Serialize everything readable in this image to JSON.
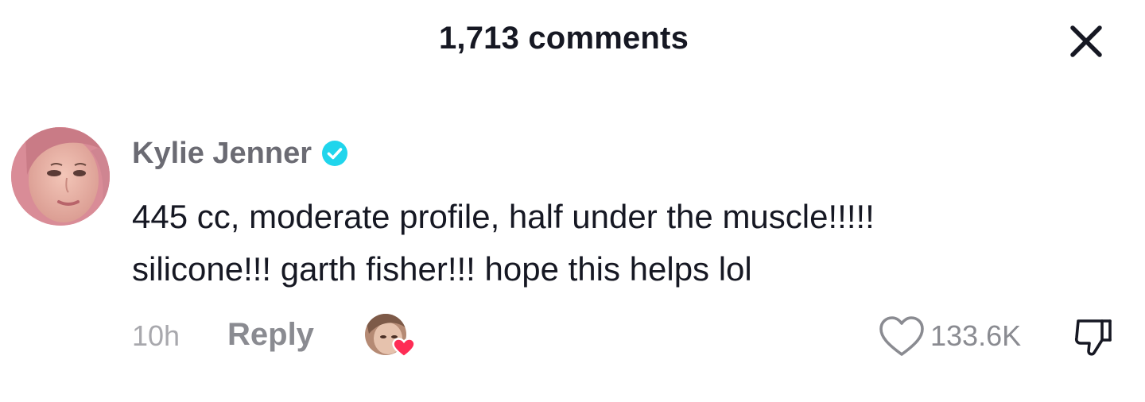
{
  "header": {
    "title": "1,713 comments",
    "close_icon": "close-icon"
  },
  "comment": {
    "username": "Kylie Jenner",
    "verified_icon": "verified-badge-icon",
    "verified_color": "#20d5ec",
    "text_line_1": "445 cc, moderate profile, half under the muscle!!!!!",
    "text_line_2": "silicone!!! garth fisher!!! hope this helps lol",
    "time": "10h",
    "reply_label": "Reply",
    "creator_liked_icon": "creator-liked-avatar-icon",
    "creator_heart_color": "#fe2c55",
    "like_icon": "heart-outline-icon",
    "like_count": "133.6K",
    "dislike_icon": "thumbs-down-icon"
  }
}
